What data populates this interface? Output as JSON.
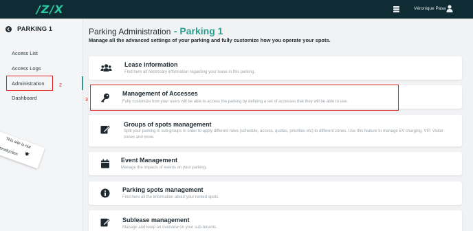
{
  "topbar": {
    "logo_text": "/Z/X",
    "user_name": "Véronique Pasa",
    "icons": {
      "stack": "stack-icon",
      "user": "user-icon"
    }
  },
  "sidebar": {
    "title": "PARKING 1",
    "back_icon": "chevron-left-circle-icon",
    "items": [
      {
        "label": "Access List"
      },
      {
        "label": "Access Logs"
      },
      {
        "label": "Administration",
        "active": true
      },
      {
        "label": "Dashboard"
      }
    ],
    "ribbon": {
      "line1": "This site is not",
      "line2": "production"
    }
  },
  "annotations": {
    "admin": "2",
    "access": "3"
  },
  "main": {
    "title": "Parking Administration",
    "title_accent": "- Parking 1",
    "subtitle": "Manage all the advanced settings of your parking and fully customize how you operate your spots.",
    "cards": [
      {
        "icon": "users-icon",
        "title": "Lease information",
        "desc": "Find here all necessary information regarding your lease in this parking."
      },
      {
        "icon": "key-icon",
        "title": "Management of Accesses",
        "desc": "Fully customize how your users will be able to access the parking by defining a set of accesses that they will be able to use."
      },
      {
        "icon": "edit-icon",
        "title": "Groups of spots management",
        "desc": "Split your parking in sub-groups in order to apply different rules (schedule, access, quotas, priorities etc) to different zones. Use this feature to manage EV charging, VIP, Visitor zones and more."
      },
      {
        "icon": "calendar-icon",
        "title": "Event Management",
        "desc": "Manage the impacts of events on your parking."
      },
      {
        "icon": "info-icon",
        "title": "Parking spots management",
        "desc": "Find here all the information about your rented spots."
      },
      {
        "icon": "sublease-icon",
        "title": "Sublease management",
        "desc": "Manage and keep an overview on your sub-tenants."
      }
    ]
  },
  "colors": {
    "topbar": "#0f2b33",
    "accent": "#2a9d8f",
    "logo": "#2cc9a0",
    "annotation": "#e01f1f"
  }
}
